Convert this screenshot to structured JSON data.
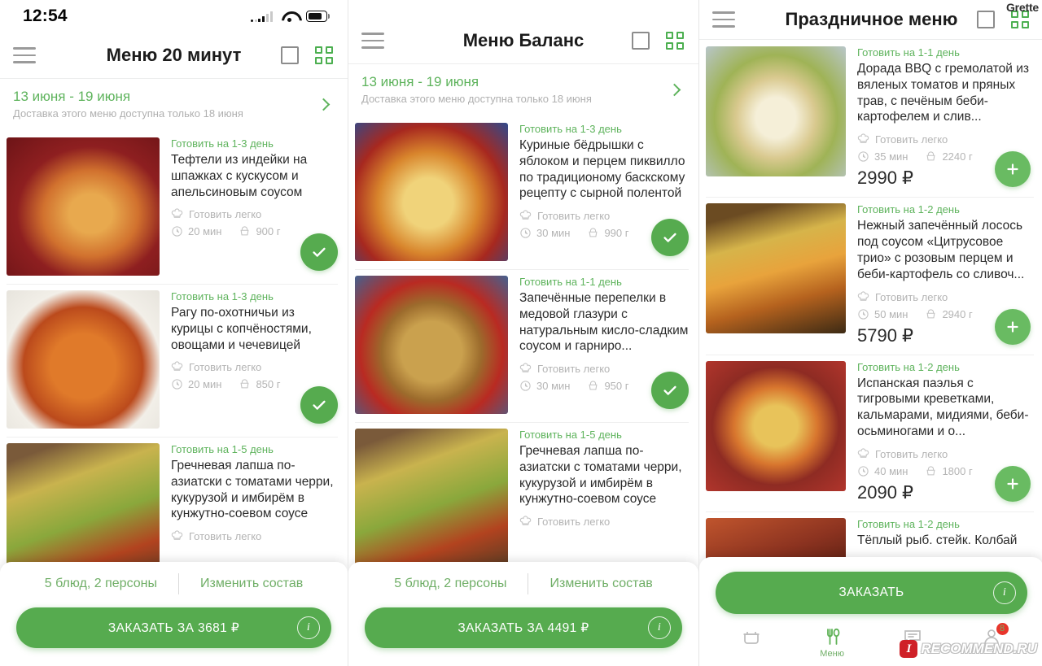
{
  "status_bar": {
    "time": "12:54",
    "icons": [
      "signal-icon",
      "wifi-icon",
      "battery-icon"
    ]
  },
  "panels": [
    {
      "id": "panel-menu-20-minut",
      "header": {
        "title": "Меню 20 минут",
        "menu_icon": "hamburger-icon",
        "square_icon": "square-view-icon",
        "grid_icon": "grid-view-icon"
      },
      "week": {
        "range": "13 июня - 19 июня",
        "note": "Доставка этого меню доступна только 18 июня",
        "chevron": "chevron-right-icon"
      },
      "dishes": [
        {
          "day": "Готовить на 1-3 день",
          "title": "Тефтели из индейки на шпажках с кускусом и апельсиновым соусом",
          "difficulty": "Готовить легко",
          "time": "20 мин",
          "weight": "900 г",
          "action": "check",
          "img": "img-tefteli"
        },
        {
          "day": "Готовить на 1-3 день",
          "title": "Рагу по-охотничьи из курицы с копчёностями, овощами и чечевицей",
          "difficulty": "Готовить легко",
          "time": "20 мин",
          "weight": "850 г",
          "action": "check",
          "img": "img-ragu"
        },
        {
          "day": "Готовить на 1-5 день",
          "title": "Гречневая лапша по-азиатски с томатами черри, кукурузой и имбирём в кунжутно-соевом соусе",
          "difficulty": "Готовить легко",
          "time": "",
          "weight": "",
          "action": "none",
          "img": "img-grechka"
        }
      ],
      "bottom_sheet": {
        "portions": "5 блюд, 2 персоны",
        "change": "Изменить состав",
        "order_button": "ЗАКАЗАТЬ ЗА 3681 ₽",
        "info_icon": "info-icon"
      }
    },
    {
      "id": "panel-menu-balans",
      "header": {
        "title": "Меню Баланс",
        "menu_icon": "hamburger-icon",
        "square_icon": "square-view-icon",
        "grid_icon": "grid-view-icon"
      },
      "week": {
        "range": "13 июня - 19 июня",
        "note": "Доставка этого меню доступна только 18 июня",
        "chevron": "chevron-right-icon"
      },
      "dishes": [
        {
          "day": "Готовить на 1-3 день",
          "title": "Куриные бёдрышки с яблоком и перцем пиквилло по традиционому баскскому рецепту с сырной полентой",
          "difficulty": "Готовить легко",
          "time": "30 мин",
          "weight": "990 г",
          "action": "check",
          "img": "img-kurinye"
        },
        {
          "day": "Готовить на 1-1 день",
          "title": "Запечённые перепелки в медовой глазури с натуральным кисло-сладким соусом и гарниро...",
          "difficulty": "Готовить легко",
          "time": "30 мин",
          "weight": "950 г",
          "action": "check",
          "img": "img-perepelki"
        },
        {
          "day": "Готовить на 1-5 день",
          "title": "Гречневая лапша по-азиатски с томатами черри, кукурузой и имбирём в кунжутно-соевом соусе",
          "difficulty": "Готовить легко",
          "time": "",
          "weight": "",
          "action": "none",
          "img": "img-grechka"
        }
      ],
      "bottom_sheet": {
        "portions": "5 блюд, 2 персоны",
        "change": "Изменить состав",
        "order_button": "ЗАКАЗАТЬ ЗА 4491 ₽",
        "info_icon": "info-icon"
      }
    },
    {
      "id": "panel-prazdnichnoe-menu",
      "header": {
        "title": "Праздничное меню",
        "menu_icon": "hamburger-icon",
        "square_icon": "square-view-icon",
        "grid_icon": "grid-view-icon"
      },
      "dishes": [
        {
          "day": "Готовить на 1-1 день",
          "title": "Дорада BBQ с гремолатой из вяленых томатов и пряных трав, с печёным беби-картофелем и слив...",
          "difficulty": "Готовить легко",
          "time": "35 мин",
          "weight": "2240 г",
          "price": "2990 ₽",
          "action": "plus",
          "img": "img-dorada"
        },
        {
          "day": "Готовить на 1-2 день",
          "title": "Нежный запечённый лосось под соусом «Цитрусовое трио» с розовым перцем и беби-картофель со сливоч...",
          "difficulty": "Готовить легко",
          "time": "50 мин",
          "weight": "2940 г",
          "price": "5790 ₽",
          "action": "plus",
          "img": "img-losos"
        },
        {
          "day": "Готовить на 1-2 день",
          "title": "Испанская паэлья с тигровыми креветками, кальмарами, мидиями, беби-осьминогами и о...",
          "difficulty": "Готовить легко",
          "time": "40 мин",
          "weight": "1800 г",
          "price": "2090 ₽",
          "action": "plus",
          "img": "img-paella"
        },
        {
          "day": "Готовить на 1-2 день",
          "title": "Тёплый рыб. стейк. Колбай",
          "difficulty": "",
          "time": "",
          "weight": "",
          "price": "",
          "action": "none",
          "img": "img-last"
        }
      ],
      "bottom_sheet": {
        "order_button": "ЗАКАЗАТЬ",
        "info_icon": "info-icon"
      },
      "tabbar": [
        {
          "icon": "pot-icon",
          "label": "",
          "active": false,
          "badge": ""
        },
        {
          "icon": "fork-spoon-icon",
          "label": "Меню",
          "active": true,
          "badge": ""
        },
        {
          "icon": "chat-icon",
          "label": "",
          "active": false,
          "badge": ""
        },
        {
          "icon": "profile-icon",
          "label": "",
          "active": false,
          "badge": "8"
        }
      ]
    }
  ],
  "watermarks": {
    "grette": "Grette",
    "recommend_logo": "I",
    "recommend": "RECOMMEND.RU"
  },
  "colors": {
    "green": "#56ab4f",
    "green_light": "#5eb35c",
    "grey_text": "#b4b4b4",
    "title": "#2b2b2b",
    "badge_red": "#e8352b"
  }
}
